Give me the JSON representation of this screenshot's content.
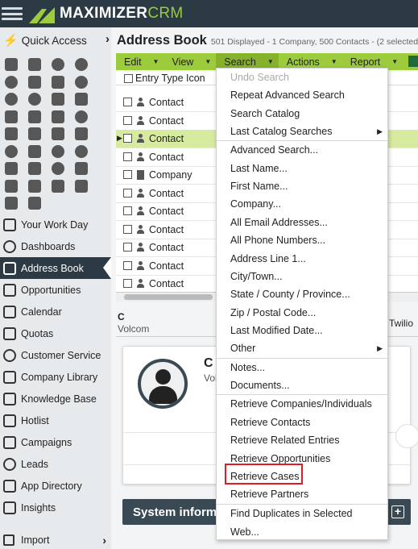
{
  "app": {
    "brand": "MAXIMIZER",
    "brand_suffix": "CRM"
  },
  "sidebar": {
    "quick_access": "Quick Access",
    "nav": [
      {
        "label": "Your Work Day",
        "name": "nav-your-work-day"
      },
      {
        "label": "Dashboards",
        "name": "nav-dashboards"
      },
      {
        "label": "Address Book",
        "name": "nav-address-book",
        "active": true
      },
      {
        "label": "Opportunities",
        "name": "nav-opportunities"
      },
      {
        "label": "Calendar",
        "name": "nav-calendar"
      },
      {
        "label": "Quotas",
        "name": "nav-quotas"
      },
      {
        "label": "Customer Service",
        "name": "nav-customer-service"
      },
      {
        "label": "Company Library",
        "name": "nav-company-library"
      },
      {
        "label": "Knowledge Base",
        "name": "nav-knowledge-base"
      },
      {
        "label": "Hotlist",
        "name": "nav-hotlist"
      },
      {
        "label": "Campaigns",
        "name": "nav-campaigns"
      },
      {
        "label": "Leads",
        "name": "nav-leads"
      },
      {
        "label": "App Directory",
        "name": "nav-app-directory"
      },
      {
        "label": "Insights",
        "name": "nav-insights"
      }
    ],
    "import": "Import"
  },
  "page": {
    "title": "Address Book",
    "subtitle": "501 Displayed - 1 Company, 500 Contacts - (2 selected)"
  },
  "toolbar": {
    "edit": "Edit",
    "view": "View",
    "search": "Search",
    "actions": "Actions",
    "report": "Report"
  },
  "grid": {
    "header": "Entry Type Icon",
    "rows": [
      {
        "type": "Contact"
      },
      {
        "type": "Contact"
      },
      {
        "type": "Contact",
        "highlighted": true
      },
      {
        "type": "Contact"
      },
      {
        "type": "Company"
      },
      {
        "type": "Contact"
      },
      {
        "type": "Contact"
      },
      {
        "type": "Contact"
      },
      {
        "type": "Contact"
      },
      {
        "type": "Contact"
      },
      {
        "type": "Contact"
      },
      {
        "type": "Contact"
      }
    ]
  },
  "detail": {
    "initial": "C",
    "company": "Volcom",
    "right_text": "Twilio",
    "card_name": "C",
    "card_company": "Vol"
  },
  "system_info": {
    "label": "System inform"
  },
  "search_menu": {
    "items": [
      {
        "label": "Undo Search",
        "disabled": true
      },
      {
        "label": "Repeat Advanced Search"
      },
      {
        "label": "Search Catalog"
      },
      {
        "label": "Last Catalog Searches",
        "submenu": true
      },
      {
        "label": "Advanced Search..."
      },
      {
        "label": "Last Name..."
      },
      {
        "label": "First Name..."
      },
      {
        "label": "Company..."
      },
      {
        "label": "All Email Addresses..."
      },
      {
        "label": "All Phone Numbers..."
      },
      {
        "label": "Address Line 1..."
      },
      {
        "label": "City/Town..."
      },
      {
        "label": "State / County / Province..."
      },
      {
        "label": "Zip / Postal Code..."
      },
      {
        "label": "Last Modified Date..."
      },
      {
        "label": "Other",
        "submenu": true
      },
      {
        "label": "Notes..."
      },
      {
        "label": "Documents..."
      },
      {
        "label": "Retrieve Companies/Individuals"
      },
      {
        "label": "Retrieve Contacts"
      },
      {
        "label": "Retrieve Related Entries"
      },
      {
        "label": "Retrieve Opportunities"
      },
      {
        "label": "Retrieve Cases",
        "highlighted": true
      },
      {
        "label": "Retrieve Partners"
      },
      {
        "label": "Find Duplicates in Selected"
      },
      {
        "label": "Web..."
      }
    ]
  },
  "colors": {
    "topbar": "#2b3a44",
    "toolbar_green": "#9ccc3c",
    "row_highlight": "#d6eba0",
    "highlight_box": "#e01b24"
  }
}
